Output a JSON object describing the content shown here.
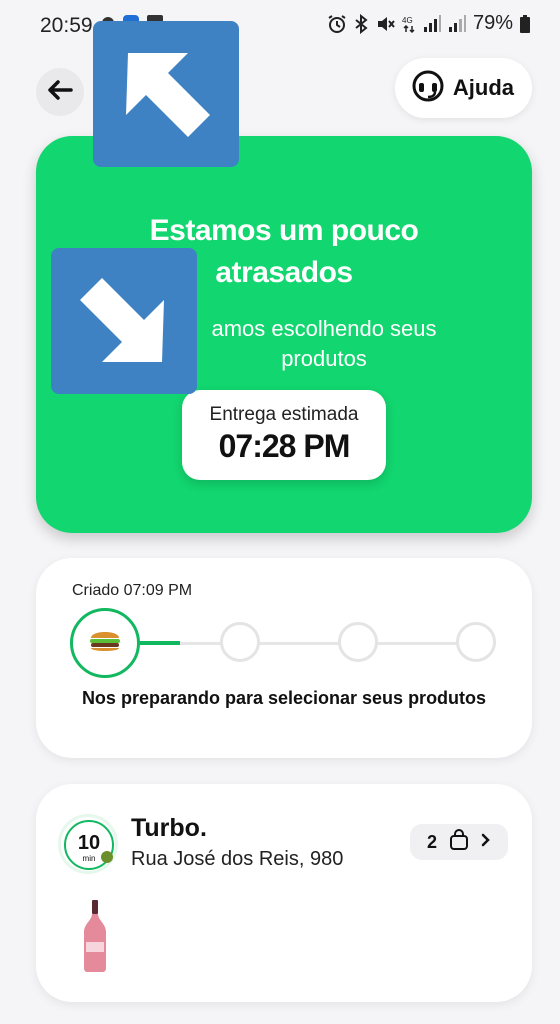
{
  "status": {
    "time": "20:59",
    "battery": "79%"
  },
  "header": {
    "help_label": "Ajuda",
    "back_icon": "arrow-left-icon",
    "help_icon": "headset-icon"
  },
  "hero": {
    "title": "Estamos um pouco atrasados",
    "subtitle_visible": "amos escolhendo seus produtos",
    "eta_label": "Entrega estimada",
    "eta_time": "07:28 PM",
    "color": "#12d66f"
  },
  "progress": {
    "created": "Criado 07:09 PM",
    "status_text": "Nos preparando para selecionar seus produtos",
    "current_step": 1,
    "total_steps": 4,
    "accent": "#12b85f"
  },
  "store": {
    "name": "Turbo.",
    "address": "Rua José dos Reis, 980",
    "logo_number": "10",
    "logo_unit": "min",
    "item_count": "2"
  }
}
